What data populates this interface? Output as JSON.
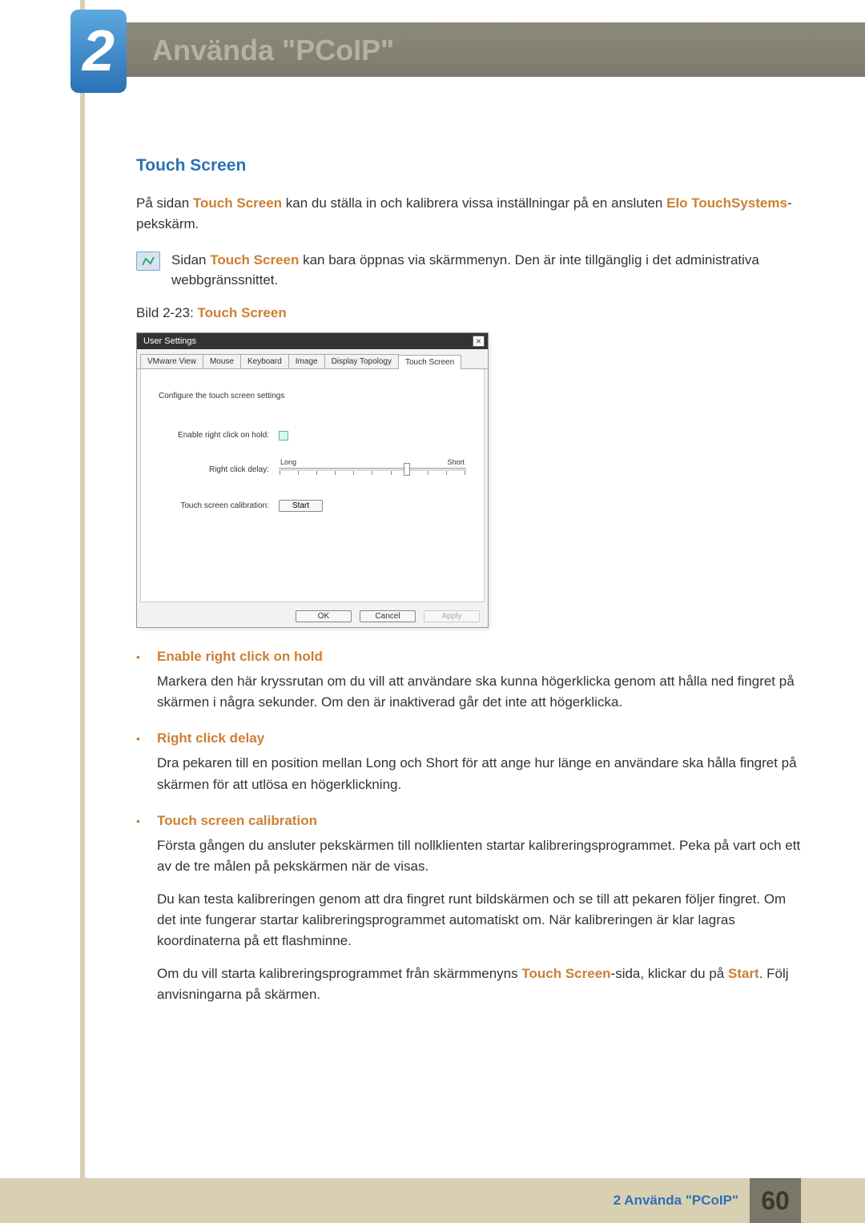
{
  "chapter": {
    "number": "2",
    "title": "Använda \"PCoIP\""
  },
  "section": {
    "heading": "Touch Screen"
  },
  "intro": {
    "p1_pre": "På sidan ",
    "p1_kw1": "Touch Screen",
    "p1_mid": " kan du ställa in och kalibrera vissa inställningar på en ansluten ",
    "p1_kw2": "Elo TouchSystems",
    "p1_post": "-pekskärm."
  },
  "note": {
    "t_pre": "Sidan ",
    "t_kw": "Touch Screen",
    "t_post": " kan bara öppnas via skärmmenyn. Den är inte tillgänglig i det administrativa webbgränssnittet."
  },
  "figure": {
    "label": "Bild 2-23: ",
    "name": "Touch Screen"
  },
  "dialog": {
    "title": "User Settings",
    "tabs": [
      "VMware View",
      "Mouse",
      "Keyboard",
      "Image",
      "Display Topology",
      "Touch Screen"
    ],
    "active_tab": 5,
    "instruction": "Configure the touch screen settings",
    "label_enable": "Enable right click on hold:",
    "label_delay": "Right click delay:",
    "slider_long": "Long",
    "slider_short": "Short",
    "label_calib": "Touch screen calibration:",
    "start_btn": "Start",
    "ok": "OK",
    "cancel": "Cancel",
    "apply": "Apply"
  },
  "bullets": {
    "b1": {
      "title": "Enable right click on hold",
      "body": "Markera den här kryssrutan om du vill att användare ska kunna högerklicka genom att hålla ned fingret på skärmen i några sekunder. Om den är inaktiverad går det inte att högerklicka."
    },
    "b2": {
      "title": "Right click delay",
      "body": "Dra pekaren till en position mellan Long och Short för att ange hur länge en användare ska hålla fingret på skärmen för att utlösa en högerklickning."
    },
    "b3": {
      "title": "Touch screen calibration",
      "p1": "Första gången du ansluter pekskärmen till nollklienten startar kalibreringsprogrammet. Peka på vart och ett av de tre målen på pekskärmen när de visas.",
      "p2": "Du kan testa kalibreringen genom att dra fingret runt bildskärmen och se till att pekaren följer fingret. Om det inte fungerar startar kalibreringsprogrammet automatiskt om. När kalibreringen är klar lagras koordinaterna på ett flashminne.",
      "p3_pre": "Om du vill starta kalibreringsprogrammet från skärmmenyns ",
      "p3_kw1": "Touch Screen",
      "p3_mid": "-sida, klickar du på ",
      "p3_kw2": "Start",
      "p3_post": ". Följ anvisningarna på skärmen."
    }
  },
  "footer": {
    "text": "2 Använda \"PCoIP\"",
    "page": "60"
  }
}
